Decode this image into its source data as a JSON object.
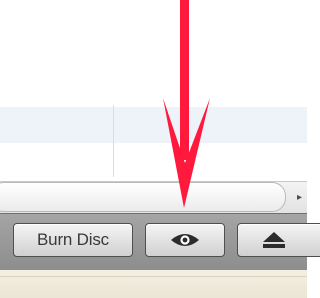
{
  "toolbar": {
    "burn_disc_label": "Burn Disc",
    "quick_look_icon": "eye-icon",
    "eject_icon": "eject-icon"
  },
  "scrollbar": {
    "right_arrow_icon": "chevron-right-icon",
    "right_arrow_glyph": "▸"
  },
  "annotation": {
    "arrow_color": "#ff1a3d"
  }
}
